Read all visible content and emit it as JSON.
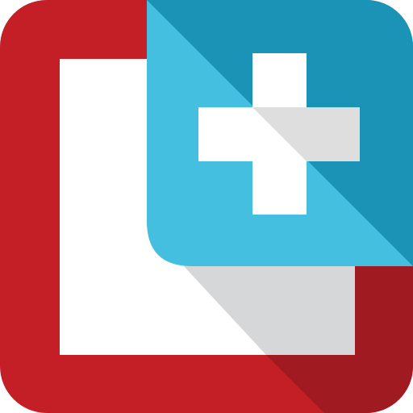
{
  "logo": {
    "name": "app-icon",
    "colors": {
      "frame_red": "#C41E26",
      "frame_red_shade": "#A01A21",
      "inner_white": "#FFFFFF",
      "shadow_grey": "#D6D7D9",
      "tile_light_blue": "#45BFDF",
      "tile_dark_blue": "#1A93B6",
      "plus_white": "#FFFFFF",
      "plus_shade": "#DEDEDE"
    },
    "icons": [
      "app-icon",
      "plus-icon"
    ]
  }
}
